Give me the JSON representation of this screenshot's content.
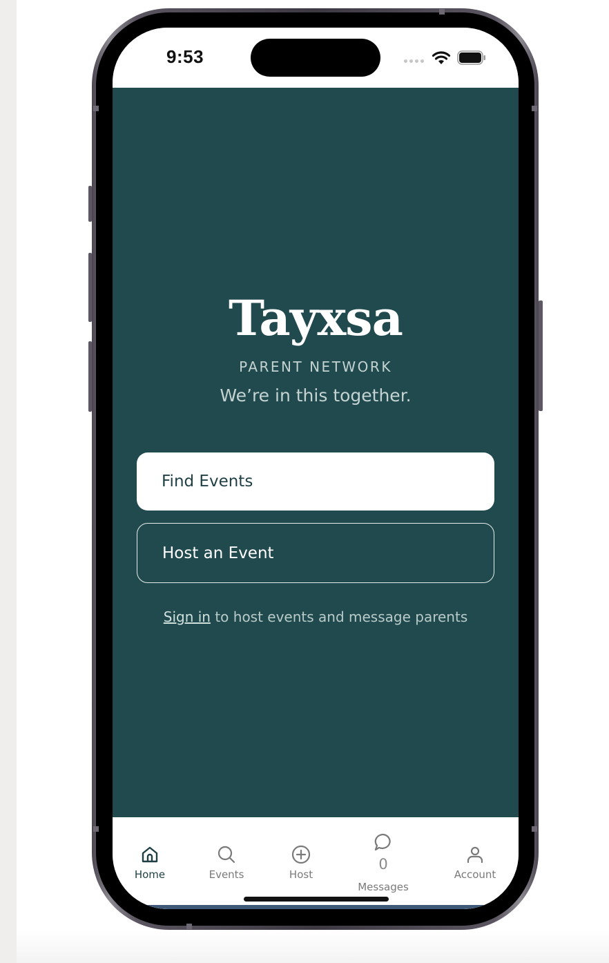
{
  "status_bar": {
    "time": "9:53"
  },
  "app": {
    "logo": "Tayxsa",
    "subtitle": "PARENT NETWORK",
    "tagline": "We’re in this together."
  },
  "actions": {
    "find_events": "Find Events",
    "host_event": "Host an Event"
  },
  "signin": {
    "link": "Sign in",
    "text": " to host events and message parents"
  },
  "tab_bar": {
    "items": [
      {
        "label": "Home",
        "icon": "home-icon",
        "active": true
      },
      {
        "label": "Events",
        "icon": "search-icon",
        "active": false
      },
      {
        "label": "Host",
        "icon": "plus-circle-icon",
        "active": false
      },
      {
        "label": "Messages",
        "icon": "chat-bubble-icon",
        "badge": "0",
        "active": false
      },
      {
        "label": "Account",
        "icon": "person-icon",
        "active": false
      }
    ]
  },
  "colors": {
    "brand": "#214a4f",
    "primary_text": "#1f3f44",
    "muted_text": "#c4d3d1"
  }
}
